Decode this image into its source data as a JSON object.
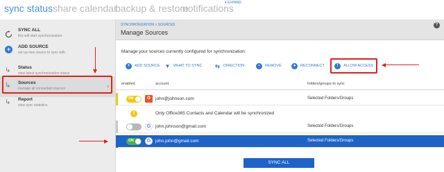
{
  "top_tabs": [
    "sync status",
    "share calendar",
    "backup & restore",
    "notifications"
  ],
  "expand_label": "EXPAND",
  "sidebar": {
    "items": [
      {
        "title": "SYNC ALL",
        "subtitle": "this will start synchronization",
        "icon": "sync-icon"
      },
      {
        "title": "ADD SOURCE",
        "subtitle": "set up new source to sync with",
        "icon": "plus-icon"
      },
      {
        "title": "Status",
        "subtitle": "view latest synchronization status",
        "icon": "arrow-icon"
      },
      {
        "title": "Sources",
        "subtitle": "manage all connected sources",
        "icon": "arrow-icon"
      },
      {
        "title": "Report",
        "subtitle": "view sync statistics",
        "icon": "arrow-icon"
      }
    ]
  },
  "header": {
    "breadcrumb": "SYNCHRONIZATION > SOURCES",
    "title": "Manage Sources",
    "help": "?"
  },
  "description": "Manage your sources currently configured for synchronization:",
  "toolbar": [
    {
      "label": "ADD SOURCE",
      "icon": "plus-icon"
    },
    {
      "label": "WHAT TO SYNC",
      "icon": "filter-icon"
    },
    {
      "label": "DIRECTION",
      "icon": "direction-icon"
    },
    {
      "label": "REMOVE",
      "icon": "trash-icon"
    },
    {
      "label": "RECONNECT",
      "icon": "reconnect-icon"
    },
    {
      "label": "ALLOW ACCESS",
      "icon": "alert-icon"
    }
  ],
  "table": {
    "headers": {
      "enabled": "enabled",
      "account": "account",
      "folders": "folders/groups to sync"
    },
    "rows": [
      {
        "toggle": "ON",
        "account": "john@johnson.com",
        "folders": "Selected Folders/Groups",
        "icon": "office365-icon",
        "toggle_color": "#f2c811"
      },
      {
        "toggle": "",
        "account": "john.johnson@gmail.com",
        "folders": "Selected Folders/Groups",
        "icon": "google-icon"
      },
      {
        "toggle": "ON",
        "account": "john.john@gmail.com",
        "folders": "Selected Folders/Groups",
        "icon": "google-icon",
        "toggle_color": "#4caf50"
      }
    ],
    "warning": "Only Office365 Contacts and Calendar will be synchronized"
  },
  "sync_all_button": "SYNC ALL",
  "colors": {
    "accent": "#2e7bd6",
    "selected_row": "#1d63c8",
    "annotation": "#e02020"
  }
}
